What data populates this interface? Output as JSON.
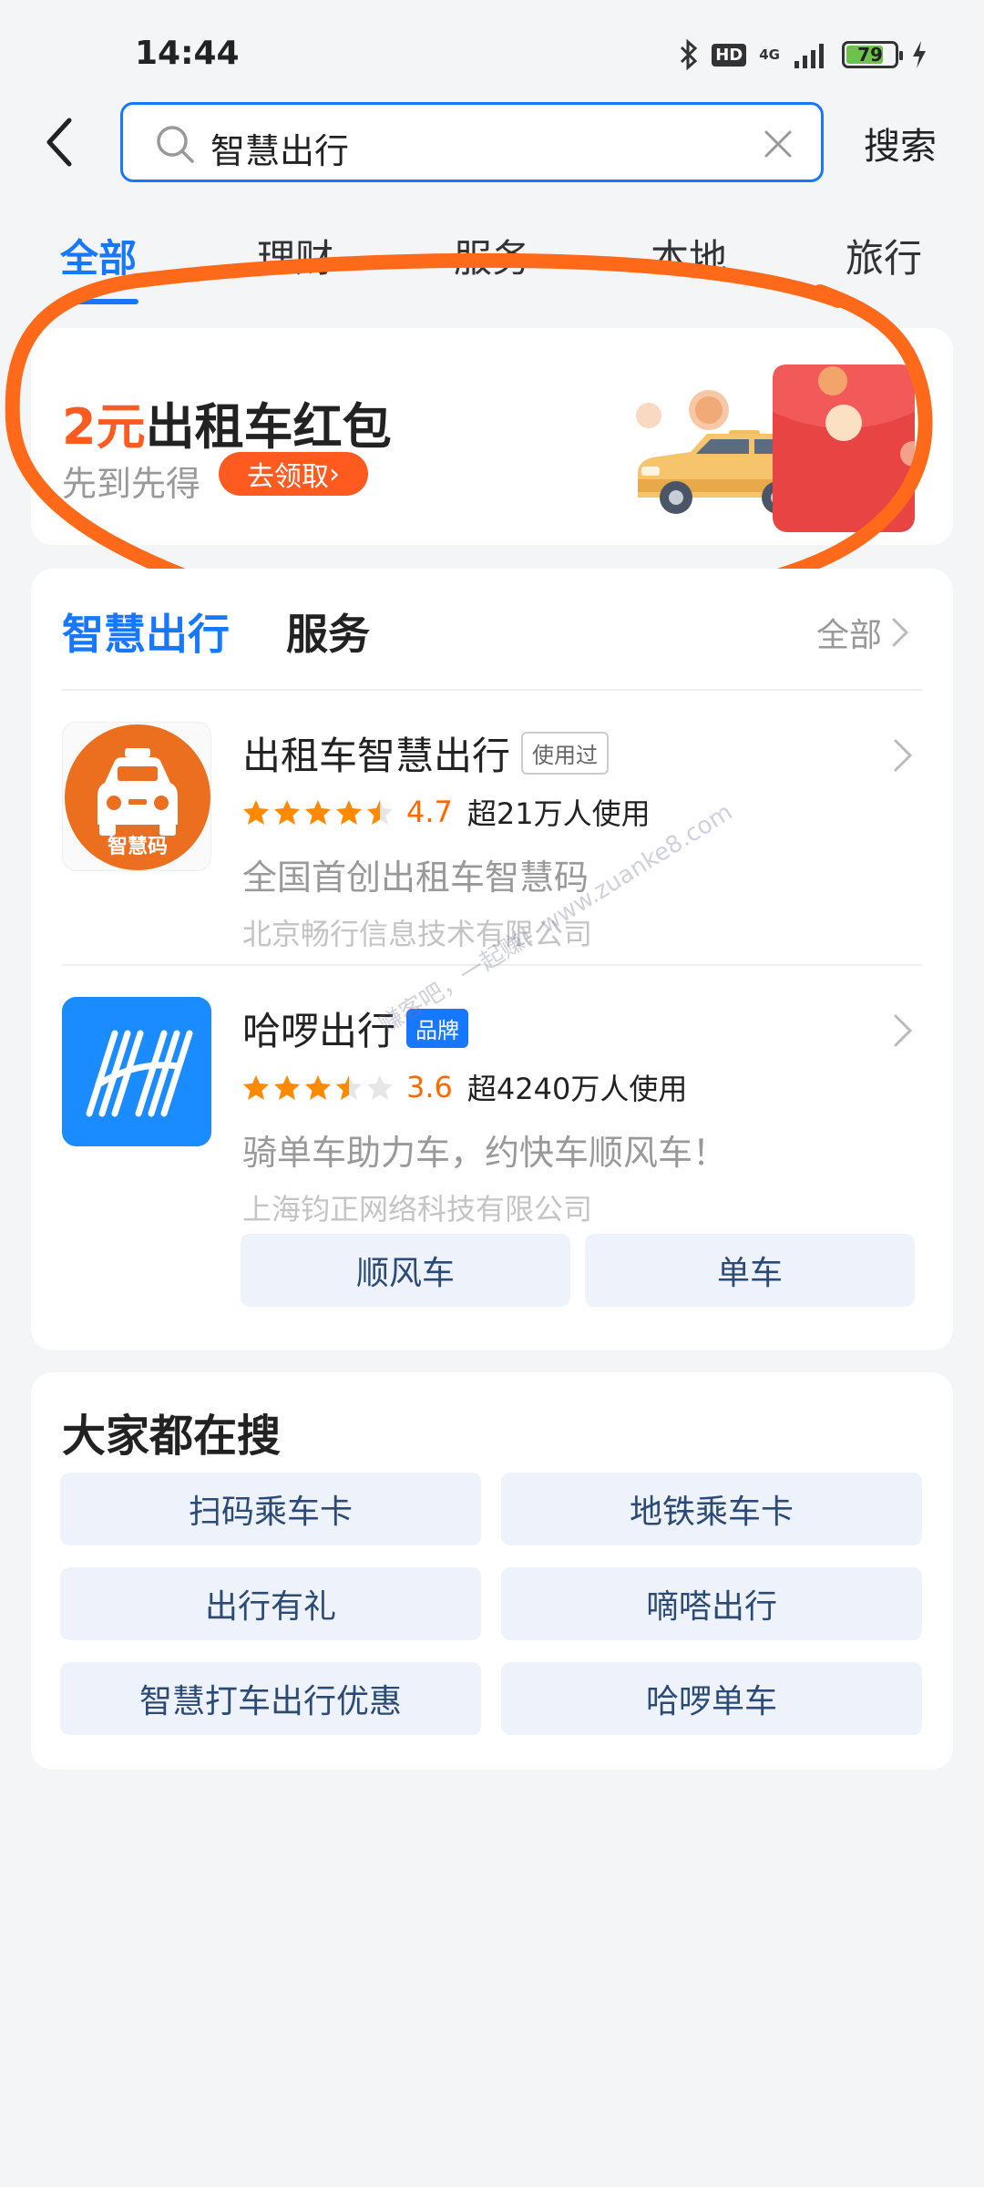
{
  "status_bar": {
    "time": "14:44",
    "hd": "HD",
    "network": "4G",
    "battery": "79",
    "battery_level_percent": 79,
    "icons": [
      "bluetooth-icon",
      "signal-icon",
      "battery-icon",
      "charging-icon"
    ]
  },
  "search": {
    "query": "智慧出行",
    "submit_label": "搜索"
  },
  "tabs": [
    {
      "label": "全部",
      "active": true
    },
    {
      "label": "理财",
      "active": false
    },
    {
      "label": "服务",
      "active": false
    },
    {
      "label": "本地",
      "active": false
    },
    {
      "label": "旅行",
      "active": false
    }
  ],
  "banner": {
    "amount": "2元",
    "title": "出租车红包",
    "subtitle": "先到先得",
    "cta": "去领取",
    "cta_arrow": "›"
  },
  "services": {
    "heading_blue": "智慧出行",
    "heading_dark": "服务",
    "all_label": "全部",
    "apps": [
      {
        "name": "出租车智慧出行",
        "tag": "使用过",
        "rating": "4.7",
        "rating_value": 4.7,
        "users": "超21万人使用",
        "desc": "全国首创出租车智慧码",
        "company": "北京畅行信息技术有限公司",
        "icon_label": "智慧码"
      },
      {
        "name": "哈啰出行",
        "tag": "品牌",
        "rating": "3.6",
        "rating_value": 3.6,
        "users": "超4240万人使用",
        "desc": "骑单车助力车，约快车顺风车！",
        "company": "上海钧正网络科技有限公司"
      }
    ],
    "sub_buttons": [
      "顺风车",
      "单车"
    ]
  },
  "watermark": "赚客吧，一起赚！www.zuanke8.com",
  "popular": {
    "title": "大家都在搜",
    "items": [
      "扫码乘车卡",
      "地铁乘车卡",
      "出行有礼",
      "嘀嗒出行",
      "智慧打车出行优惠",
      "哈啰单车"
    ]
  },
  "colors": {
    "accent_blue": "#1677ff",
    "accent_orange": "#ff5a1f",
    "star": "#ff8a00",
    "annotation": "#ff6a1a"
  }
}
